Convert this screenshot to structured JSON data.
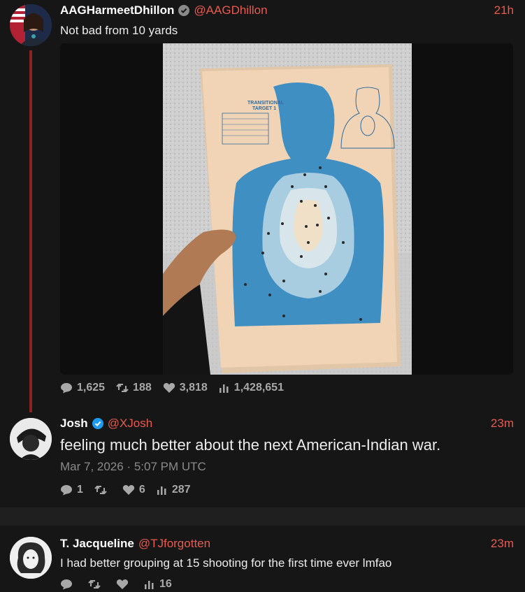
{
  "accent": "#e85a4f",
  "posts": [
    {
      "name": "AAGHarmeetDhillon",
      "handle": "@AAGDhillon",
      "time": "21h",
      "text": "Not bad from 10 yards",
      "image_alt_target_title_1": "TRANSITIONAL",
      "image_alt_target_title_2": "TARGET 1",
      "stats": {
        "replies": "1,625",
        "reposts": "188",
        "likes": "3,818",
        "views": "1,428,651"
      }
    },
    {
      "name": "Josh",
      "handle": "@XJosh",
      "time": "23m",
      "text": "feeling much better about the next American-Indian war.",
      "date": "Mar 7, 2026 · 5:07 PM UTC",
      "stats": {
        "replies": "1",
        "reposts": "",
        "likes": "6",
        "views": "287"
      }
    },
    {
      "name": "T. Jacqueline",
      "handle": "@TJforgotten",
      "time": "23m",
      "text": "I had better grouping at 15 shooting for the first time ever lmfao",
      "stats": {
        "replies": "",
        "reposts": "",
        "likes": "",
        "views": "16"
      }
    }
  ]
}
